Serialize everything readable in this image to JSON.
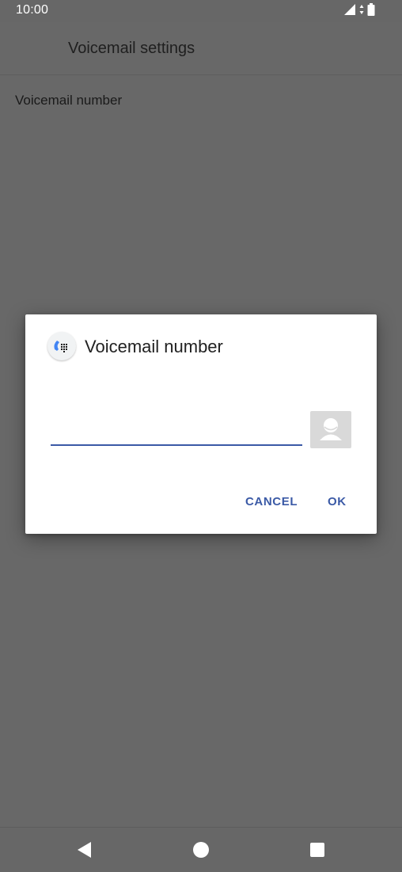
{
  "status_bar": {
    "time": "10:00",
    "icons": [
      "signal-icon",
      "data-arrows-icon",
      "battery-icon"
    ]
  },
  "app_bar": {
    "title": "Voicemail settings"
  },
  "preferences": {
    "voicemail_number_label": "Voicemail number"
  },
  "dialog": {
    "icon": "phone-dialpad-icon",
    "title": "Voicemail number",
    "input_value": "",
    "contact_picker_icon": "contact-icon",
    "cancel_label": "CANCEL",
    "ok_label": "OK"
  },
  "nav_bar": {
    "icons": [
      "back-icon",
      "home-icon",
      "recents-icon"
    ]
  },
  "colors": {
    "accent": "#3b5aa6",
    "scrim": "#686868",
    "dialog_bg": "#ffffff"
  }
}
